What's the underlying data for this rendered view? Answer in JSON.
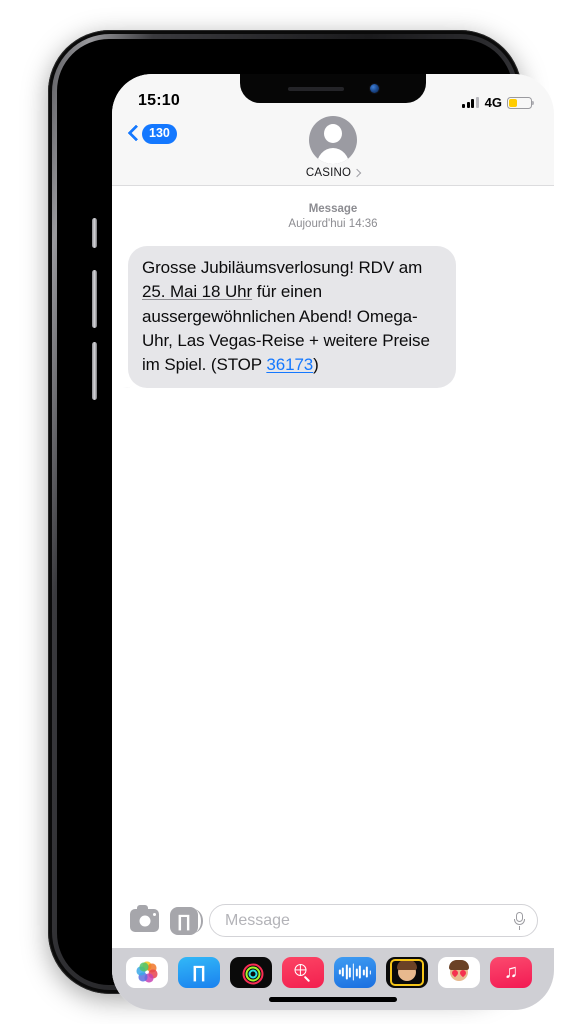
{
  "status_bar": {
    "time": "15:10",
    "network": "4G",
    "signal_icon": "signal-bars-icon",
    "battery_icon": "battery-icon",
    "battery_level_percent": 38,
    "battery_color": "#ffcc00"
  },
  "nav": {
    "back_icon": "chevron-left-icon",
    "back_badge": "130",
    "badge_color": "#1478ff",
    "avatar_icon": "person-avatar-icon",
    "contact_name": "CASINO",
    "contact_chevron_icon": "chevron-right-icon"
  },
  "conversation": {
    "meta_kind": "Message",
    "meta_timestamp": "Aujourd'hui 14:36",
    "messages": [
      {
        "sender": "incoming",
        "segments": [
          {
            "type": "text",
            "value": "Grosse Jubiläumsverlosung! RDV am "
          },
          {
            "type": "date-link",
            "value": "25. Mai 18 Uhr"
          },
          {
            "type": "text",
            "value": " für einen aussergewöhnlichen Abend! Omega-Uhr, Las Vegas-Reise + weitere Preise im Spiel. (STOP "
          },
          {
            "type": "tel-link",
            "value": "36173"
          },
          {
            "type": "text",
            "value": ")"
          }
        ],
        "full_text": "Grosse Jubiläumsverlosung! RDV am 25. Mai 18 Uhr für einen aussergewöhnlichen Abend! Omega-Uhr, Las Vegas-Reise + weitere Preise im Spiel. (STOP 36173)",
        "bubble_color": "#e6e6e9",
        "link_color": "#1478ff"
      }
    ]
  },
  "input_bar": {
    "camera_icon": "camera-icon",
    "appstore_icon": "app-store-icon",
    "placeholder": "Message",
    "mic_icon": "microphone-icon"
  },
  "app_drawer": {
    "apps": [
      {
        "name": "photos-app-icon",
        "label": "Photos"
      },
      {
        "name": "app-store-app-icon",
        "label": "App Store"
      },
      {
        "name": "fitness-rings-app-icon",
        "label": "Fitness"
      },
      {
        "name": "images-search-app-icon",
        "label": "#images"
      },
      {
        "name": "audio-message-app-icon",
        "label": "Audio"
      },
      {
        "name": "memoji-app-icon",
        "label": "Memoji"
      },
      {
        "name": "memoji-stickers-app-icon",
        "label": "Memoji Stickers"
      },
      {
        "name": "music-app-icon",
        "label": "Music"
      }
    ],
    "home_indicator_icon": "home-indicator"
  }
}
